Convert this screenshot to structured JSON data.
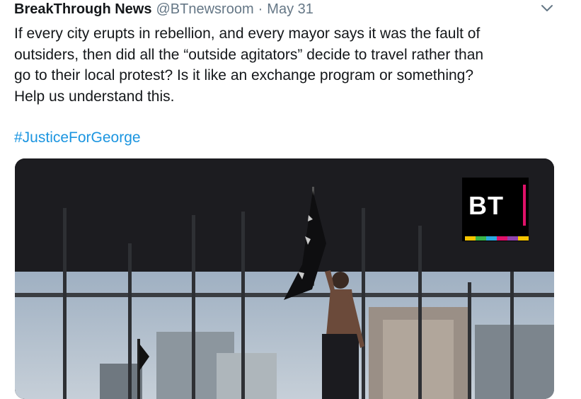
{
  "tweet": {
    "author_name": "BreakThrough News",
    "handle": "@BTnewsroom",
    "separator": "·",
    "date": "May 31",
    "text": "If every city erupts in rebellion, and every mayor says it was the fault of\noutsiders, then did all the “outside agitators” decide to travel rather than\ngo to their local protest? Is it like an exchange program or something?\nHelp us understand this.",
    "hashtag": "#JusticeForGeorge",
    "menu_icon": "chevron-down-icon"
  },
  "media": {
    "type": "video-frame",
    "logo": {
      "text": "BT",
      "accent": "#e0116a",
      "stripe_colors": [
        "#f5c400",
        "#3ab54a",
        "#2aa9e0",
        "#e0116a",
        "#8e44ad",
        "#f5c400"
      ]
    }
  },
  "colors": {
    "text": "#14171a",
    "secondary": "#657786",
    "link": "#1b95e0"
  }
}
